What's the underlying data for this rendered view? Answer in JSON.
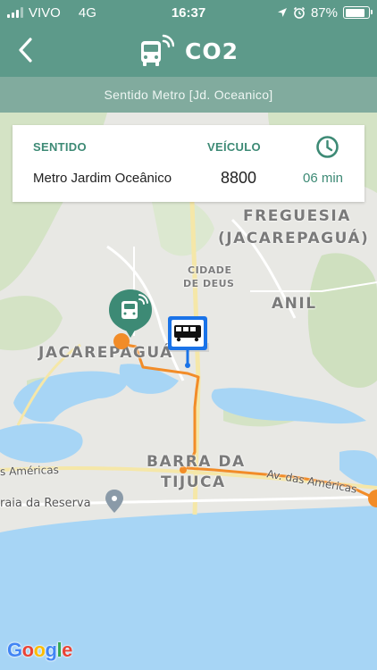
{
  "status_bar": {
    "carrier": "VIVO",
    "network": "4G",
    "time": "16:37",
    "battery": "87%",
    "battery_level": 0.87,
    "icons": [
      "signal-icon",
      "location-arrow-icon",
      "alarm-icon",
      "battery-icon"
    ]
  },
  "nav": {
    "title": "CO2",
    "icons": [
      "back-chevron-icon",
      "bus-wifi-icon"
    ]
  },
  "direction": {
    "text": "Sentido Metro [Jd. Oceanico]"
  },
  "card": {
    "sentido_header": "SENTIDO",
    "veiculo_header": "VEÍCULO",
    "sentido_value": "Metro Jardim Oceânico",
    "veiculo_value": "8800",
    "eta_value": "06 min",
    "icon": "clock-icon"
  },
  "map": {
    "labels": {
      "freguesia": "FREGUESIA",
      "jacarepagua_paren": "(JACAREPAGUÁ)",
      "cidade": "CIDADE",
      "de_deus": "DE DEUS",
      "anil": "ANIL",
      "jacarepagua": "JACAREPAGUÁ",
      "barra_da": "BARRA DA",
      "tijuca": "TIJUCA",
      "americas_left": "s Américas",
      "americas_right": "Av. das Américas",
      "reserva": "raia da Reserva"
    },
    "google": "Google",
    "colors": {
      "route": "#f28c28",
      "water": "#a7d5f5",
      "park": "#d6e6c8",
      "accent": "#3d8a75",
      "bus_marker": "#3d8a75",
      "stop_marker": "#1a73e8"
    }
  }
}
